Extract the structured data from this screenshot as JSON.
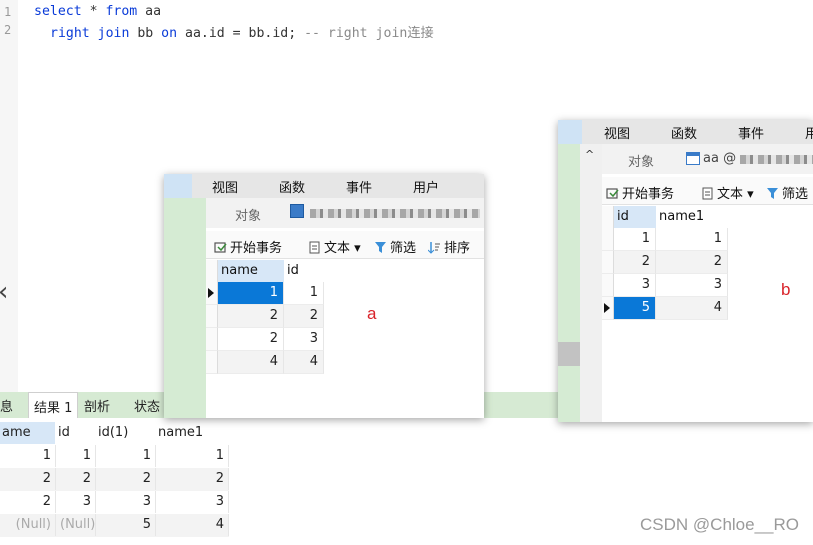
{
  "editor": {
    "line_numbers": [
      "1",
      "2"
    ],
    "line1": {
      "kw1": "select",
      "t1": " * ",
      "kw2": "from",
      "t2": " aa"
    },
    "line2": {
      "kw1": "right join",
      "t1": " bb ",
      "kw2": "on",
      "t2": " aa.id = bb.id; ",
      "comment": "-- right join连接"
    }
  },
  "result": {
    "tabs": [
      "息",
      "结果 1",
      "剖析",
      "状态"
    ],
    "columns": [
      "ame",
      "id",
      "id(1)",
      "name1"
    ],
    "rows": [
      [
        "1",
        "1",
        "1",
        "1"
      ],
      [
        "2",
        "2",
        "2",
        "2"
      ],
      [
        "2",
        "3",
        "3",
        "3"
      ],
      [
        "(Null)",
        "(Null)",
        "5",
        "4"
      ]
    ]
  },
  "window_a": {
    "menu": [
      "视图",
      "函数",
      "事件",
      "用户"
    ],
    "object_tab": "对象",
    "toolbar": {
      "begin_tx": "开始事务",
      "text": "文本",
      "filter": "筛选",
      "sort": "排序"
    },
    "columns": [
      "name",
      "id"
    ],
    "rows": [
      [
        "1",
        "1"
      ],
      [
        "2",
        "2"
      ],
      [
        "2",
        "3"
      ],
      [
        "4",
        "4"
      ]
    ],
    "label": "a"
  },
  "window_b": {
    "menu": [
      "视图",
      "函数",
      "事件",
      "用"
    ],
    "object_tab": "对象",
    "table_tab": "aa @",
    "toolbar": {
      "begin_tx": "开始事务",
      "text": "文本",
      "filter": "筛选"
    },
    "columns": [
      "id",
      "name1"
    ],
    "rows": [
      [
        "1",
        "1"
      ],
      [
        "2",
        "2"
      ],
      [
        "3",
        "3"
      ],
      [
        "5",
        "4"
      ]
    ],
    "label": "b"
  },
  "watermark": "CSDN @Chloe__RO",
  "colors": {
    "keyword": "#0a3bd8",
    "selection": "#0a78d7",
    "green_panel": "#d5ebd3",
    "red_label": "#d9232a"
  }
}
